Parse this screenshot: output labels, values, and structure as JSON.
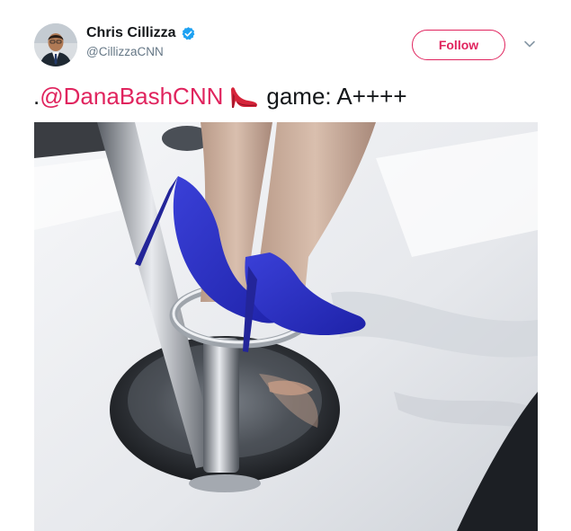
{
  "tweet": {
    "author_name": "Chris Cillizza",
    "author_handle": "@CillizzaCNN",
    "verified": true,
    "follow_label": "Follow",
    "text_prefix": ".",
    "mention": "@DanaBashCNN",
    "emoji": "high-heel-shoe",
    "text_suffix": "game: A++++"
  },
  "colors": {
    "accent": "#e0245e",
    "verified_badge": "#1da1f2",
    "text_primary": "#14171a",
    "text_secondary": "#657786",
    "shoe_blue": "#2a2fc4"
  },
  "icons": {
    "verified": "verified-badge-icon",
    "caret": "chevron-down-icon"
  }
}
